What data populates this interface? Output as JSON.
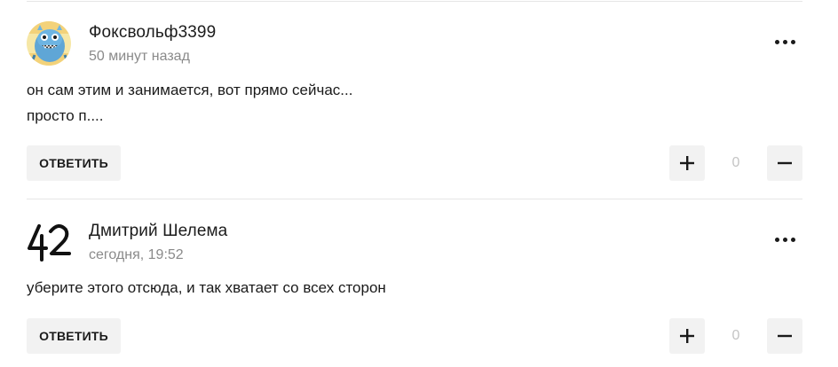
{
  "comments": [
    {
      "author": "Фоксвольф3399",
      "time": "50 минут назад",
      "avatar_icon": "blue-monster-icon",
      "lines": [
        "он сам этим и занимается, вот прямо сейчас...",
        "просто п...."
      ],
      "reply_label": "ОТВЕТИТЬ",
      "score": "0"
    },
    {
      "author": "Дмитрий Шелема",
      "time": "сегодня, 19:52",
      "avatar_icon": "number-42-icon",
      "avatar_text": "42",
      "lines": [
        "уберите этого отсюда, и так хватает со всех сторон"
      ],
      "reply_label": "ОТВЕТИТЬ",
      "score": "0"
    }
  ],
  "colors": {
    "button_bg": "#f2f2f2",
    "muted_text": "#8a8a8a",
    "score_text": "#c4c4c4",
    "divider": "#e6e6e6"
  }
}
